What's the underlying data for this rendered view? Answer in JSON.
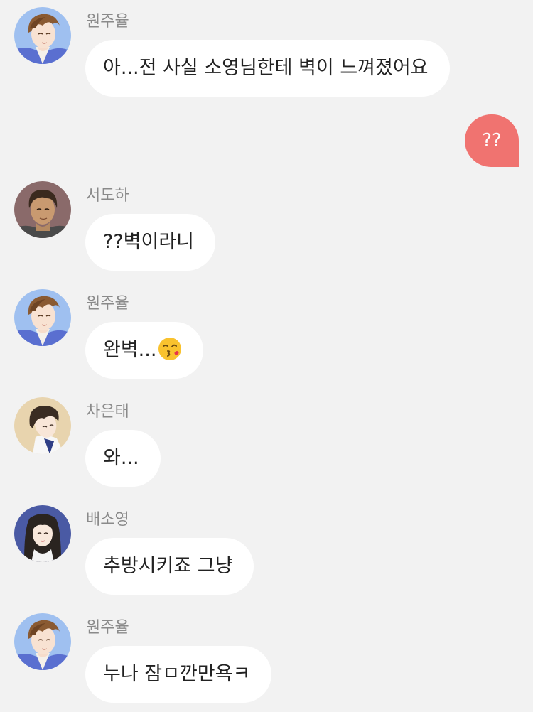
{
  "messages": [
    {
      "sender": "원주율",
      "text": "아...전 사실 소영님한테 벽이 느껴졌어요",
      "avatar": "avatar-juyul"
    },
    {
      "mine": true,
      "text": "??"
    },
    {
      "sender": "서도하",
      "text": "??벽이라니",
      "avatar": "avatar-doha"
    },
    {
      "sender": "원주율",
      "text": "완벽...",
      "emoji": "kissing-face-emoji",
      "avatar": "avatar-juyul"
    },
    {
      "sender": "차은태",
      "text": "와...",
      "avatar": "avatar-euntae"
    },
    {
      "sender": "배소영",
      "text": "추방시키죠 그냥",
      "avatar": "avatar-soyoung"
    },
    {
      "sender": "원주율",
      "text": "누나 잠ㅁ깐만욕ㅋ",
      "avatar": "avatar-juyul"
    }
  ],
  "colors": {
    "background": "#f2f2f2",
    "bubble": "#ffffff",
    "my_bubble": "#f07370",
    "sender_name": "#8a8a8a",
    "text": "#222222"
  }
}
